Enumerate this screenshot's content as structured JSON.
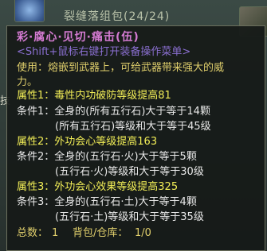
{
  "background": {
    "window_title": "裂缝落组包(24/24)",
    "side_label": "技"
  },
  "tooltip": {
    "title": "彩·腐心·见切·痛击(伍)",
    "hint": "<Shift+鼠标右键打开装备操作菜单>",
    "usage_line1": "使用：熔嵌到武器上，可给武器带来强大的威",
    "usage_line2": "力。",
    "lines": [
      {
        "kind": "attr",
        "text": "属性1：毒性内功破防等级提高81"
      },
      {
        "kind": "cond",
        "text": "条件1：全身的(所有五行石)大于等于14颗"
      },
      {
        "kind": "cond",
        "text": "(所有五行石)等级和大于等于45级"
      },
      {
        "kind": "attr",
        "text": "属性2：外功会心等级提高163"
      },
      {
        "kind": "cond",
        "text": "条件2：全身的(五行石·火)大于等于5颗"
      },
      {
        "kind": "cond",
        "text": "(五行石·火)等级和大于等于30级"
      },
      {
        "kind": "attr",
        "text": "属性3：外功会心效果等级提高325"
      },
      {
        "kind": "cond",
        "text": "条件3：全身的(五行石·土)大于等于4颗"
      },
      {
        "kind": "cond",
        "text": "(五行石·土)等级和大于等于35级"
      }
    ],
    "footer_total_label": "总数：",
    "footer_total_value": "1",
    "footer_storage_label": "背包/仓库：",
    "footer_storage_value": "1/0"
  }
}
